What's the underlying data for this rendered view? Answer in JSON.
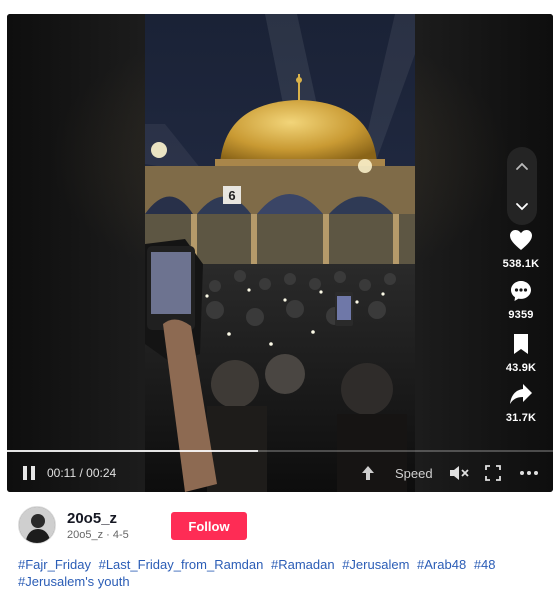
{
  "video": {
    "overlay_number": "6",
    "time_current": "00:11",
    "time_total": "00:24",
    "time_separator": "/",
    "progress": 0.46,
    "speed_label": "Speed"
  },
  "actions": {
    "likes": "538.1K",
    "comments": "9359",
    "saves": "43.9K",
    "shares": "31.7K"
  },
  "author": {
    "username": "20o5_z",
    "handle": "20o5_z",
    "separator": "·",
    "date": "4-5",
    "follow_label": "Follow"
  },
  "caption": {
    "hashtags": [
      "#Fajr_Friday",
      "#Last_Friday_from_Ramdan",
      "#Ramadan",
      "#Jerusalem",
      "#Arab48",
      "#48",
      "#Jerusalem's youth"
    ]
  },
  "icons": {
    "nav_up": "chevron-up-icon",
    "nav_down": "chevron-down-icon",
    "like": "heart-icon",
    "comment": "comment-icon",
    "save": "bookmark-icon",
    "share": "share-icon",
    "pause": "pause-icon",
    "float": "float-icon",
    "mute": "volume-mute-icon",
    "fullscreen": "fullscreen-icon",
    "more": "more-icon"
  },
  "colors": {
    "follow_button": "#fe2c55",
    "hashtag": "#2b5db6",
    "player_bg": "#141414"
  }
}
